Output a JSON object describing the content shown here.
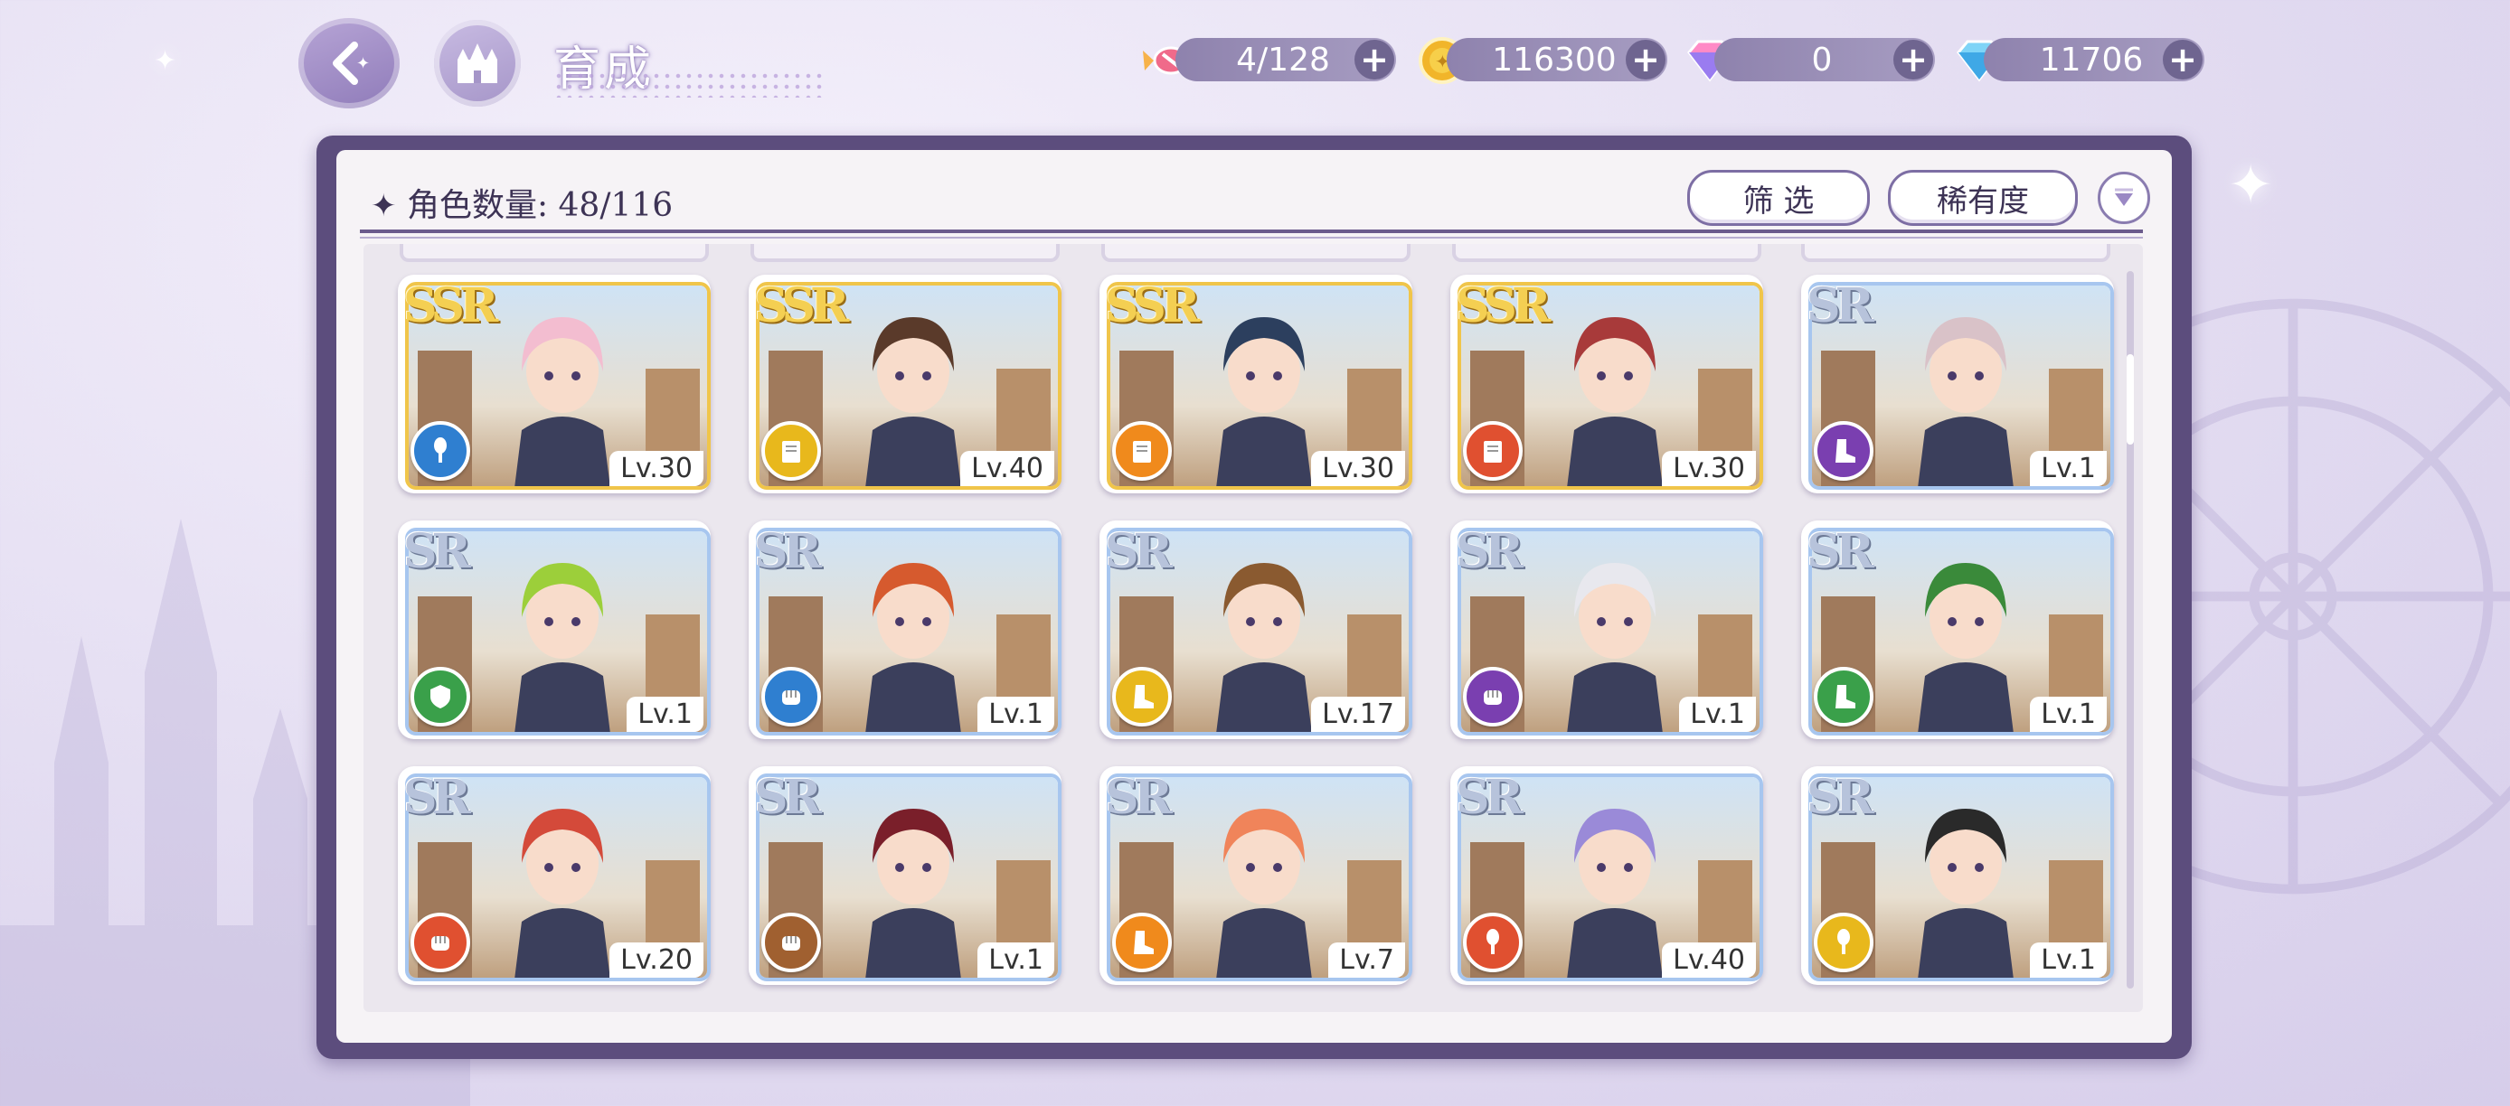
{
  "header": {
    "title": "育成",
    "resources": [
      {
        "name": "candy",
        "icon": "candy-icon",
        "value": "4/128"
      },
      {
        "name": "gold",
        "icon": "gold-coin-icon",
        "value": "116300"
      },
      {
        "name": "pink-gem",
        "icon": "pink-gem-icon",
        "value": "0"
      },
      {
        "name": "blue-gem",
        "icon": "blue-diamond-icon",
        "value": "11706"
      }
    ]
  },
  "panel": {
    "count_label": "角色数量: 48/116",
    "filter_label": "筛 选",
    "rarity_sort_label": "稀有度"
  },
  "colors": {
    "ssr_border": "#f0c54a",
    "sr_border": "#a7c6ef",
    "attr_blue": "#2f7fd0",
    "attr_yellow": "#e8b81c",
    "attr_orange": "#f08a1c",
    "attr_red": "#e05030",
    "attr_purple": "#7a3fb0",
    "attr_green": "#3aa04a",
    "attr_brown": "#a06030"
  },
  "cards": [
    {
      "rarity": "SSR",
      "level": "Lv.30",
      "attr": "attr_blue",
      "attr_icon": "microphone-icon",
      "hair": "#f3bdd0"
    },
    {
      "rarity": "SSR",
      "level": "Lv.40",
      "attr": "attr_yellow",
      "attr_icon": "book-icon",
      "hair": "#5a3a2a"
    },
    {
      "rarity": "SSR",
      "level": "Lv.30",
      "attr": "attr_orange",
      "attr_icon": "book-icon",
      "hair": "#2c3f5e"
    },
    {
      "rarity": "SSR",
      "level": "Lv.30",
      "attr": "attr_red",
      "attr_icon": "book-icon",
      "hair": "#a83a3a"
    },
    {
      "rarity": "SR",
      "level": "Lv.1",
      "attr": "attr_purple",
      "attr_icon": "boot-icon",
      "hair": "#d9c2c8"
    },
    {
      "rarity": "SR",
      "level": "Lv.1",
      "attr": "attr_green",
      "attr_icon": "shield-icon",
      "hair": "#9ccf3a"
    },
    {
      "rarity": "SR",
      "level": "Lv.1",
      "attr": "attr_blue",
      "attr_icon": "fist-icon",
      "hair": "#d65a2e"
    },
    {
      "rarity": "SR",
      "level": "Lv.17",
      "attr": "attr_yellow",
      "attr_icon": "boot-icon",
      "hair": "#8a5a30"
    },
    {
      "rarity": "SR",
      "level": "Lv.1",
      "attr": "attr_purple",
      "attr_icon": "fist-icon",
      "hair": "#e8e8ee"
    },
    {
      "rarity": "SR",
      "level": "Lv.1",
      "attr": "attr_green",
      "attr_icon": "boot-icon",
      "hair": "#3a8a3a"
    },
    {
      "rarity": "SR",
      "level": "Lv.20",
      "attr": "attr_red",
      "attr_icon": "fist-icon",
      "hair": "#d44a3a"
    },
    {
      "rarity": "SR",
      "level": "Lv.1",
      "attr": "attr_brown",
      "attr_icon": "fist-icon",
      "hair": "#7a1f2a"
    },
    {
      "rarity": "SR",
      "level": "Lv.7",
      "attr": "attr_orange",
      "attr_icon": "boot-icon",
      "hair": "#f0845a"
    },
    {
      "rarity": "SR",
      "level": "Lv.40",
      "attr": "attr_red",
      "attr_icon": "microphone-icon",
      "hair": "#9a8ad8"
    },
    {
      "rarity": "SR",
      "level": "Lv.1",
      "attr": "attr_yellow",
      "attr_icon": "microphone-icon",
      "hair": "#2a2a2a"
    }
  ]
}
